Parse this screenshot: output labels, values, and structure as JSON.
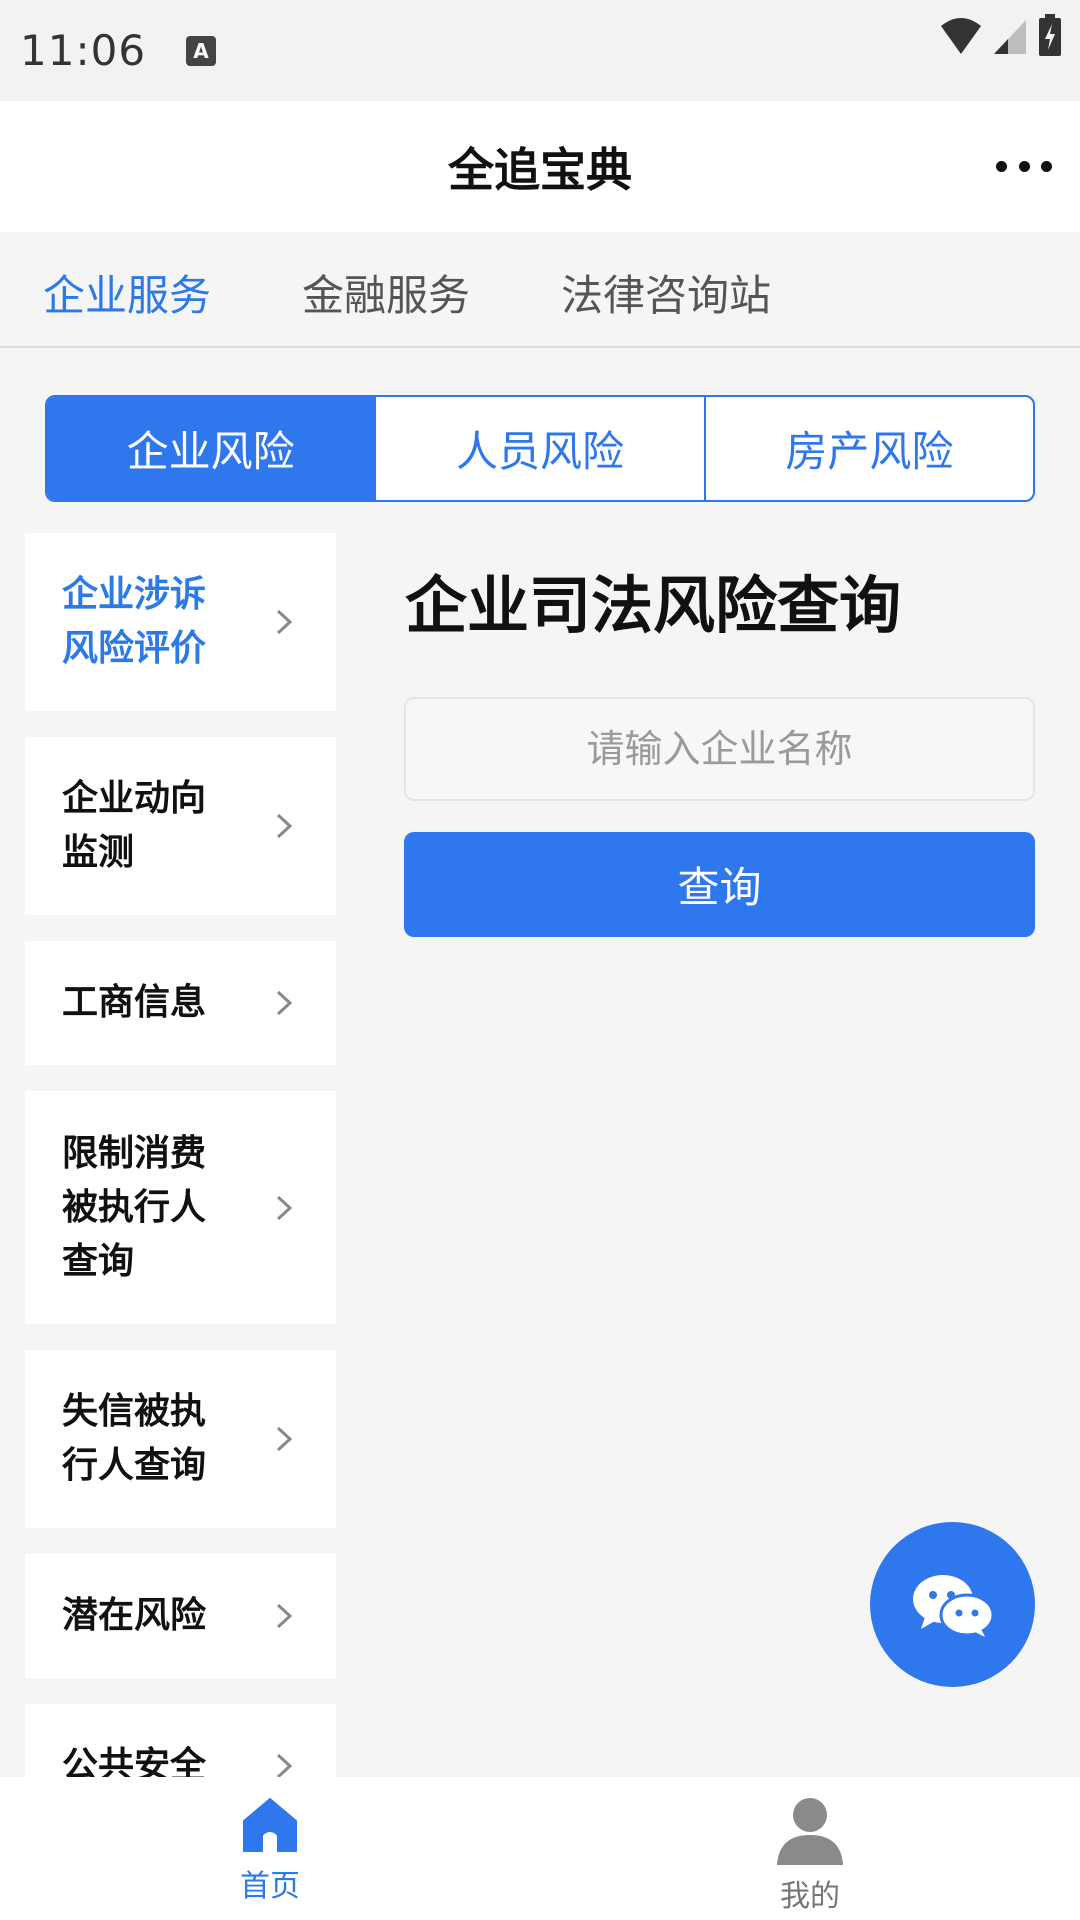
{
  "status_bar": {
    "time": "11:06",
    "notification_icon_letter": "A"
  },
  "header": {
    "title": "全追宝典",
    "more_icon": "more-dots-icon"
  },
  "top_tabs": [
    {
      "label": "企业服务",
      "active": true
    },
    {
      "label": "金融服务",
      "active": false
    },
    {
      "label": "法律咨询站",
      "active": false
    }
  ],
  "risk_tabs": [
    {
      "label": "企业风险",
      "active": true
    },
    {
      "label": "人员风险",
      "active": false
    },
    {
      "label": "房产风险",
      "active": false
    }
  ],
  "sidebar": {
    "items": [
      {
        "label": "企业涉诉风险评价",
        "active": true
      },
      {
        "label": "企业动向监测",
        "active": false
      },
      {
        "label": "工商信息",
        "active": false
      },
      {
        "label": "限制消费被执行人查询",
        "active": false
      },
      {
        "label": "失信被执行人查询",
        "active": false
      },
      {
        "label": "潜在风险",
        "active": false
      },
      {
        "label": "公共安全",
        "active": false
      }
    ]
  },
  "main": {
    "title": "企业司法风险查询",
    "search_placeholder": "请输入企业名称",
    "search_value": "",
    "query_label": "查询"
  },
  "fab": {
    "icon": "wechat-icon"
  },
  "bottom_nav": [
    {
      "label": "首页",
      "icon": "home-icon",
      "active": true
    },
    {
      "label": "我的",
      "icon": "user-icon",
      "active": false
    }
  ],
  "colors": {
    "accent": "#2f77ec",
    "text_active": "#2b7ae6",
    "background": "#f5f5f5"
  }
}
